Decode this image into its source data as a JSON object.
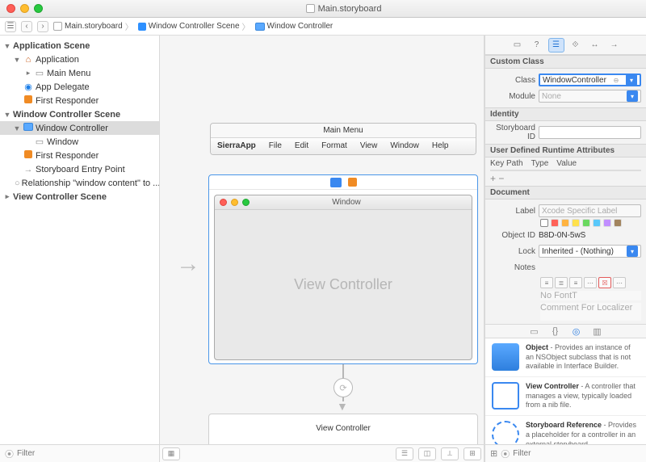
{
  "window_title": "Main.storyboard",
  "breadcrumb": [
    "Main.storyboard",
    "Window Controller Scene",
    "Window Controller"
  ],
  "outline": {
    "app_scene": "Application Scene",
    "application": "Application",
    "main_menu": "Main Menu",
    "app_delegate": "App Delegate",
    "first_responder": "First Responder",
    "wc_scene": "Window Controller Scene",
    "window_controller": "Window Controller",
    "window": "Window",
    "entry_point": "Storyboard Entry Point",
    "relationship": "Relationship \"window content\" to ...",
    "vc_scene": "View Controller Scene",
    "filter_placeholder": "Filter"
  },
  "canvas": {
    "menu_title": "Main Menu",
    "menu_items": [
      "SierraApp",
      "File",
      "Edit",
      "Format",
      "View",
      "Window",
      "Help"
    ],
    "window_title": "Window",
    "vc_placeholder": "View Controller",
    "vc_box": "View Controller"
  },
  "inspector": {
    "custom_class_hdr": "Custom Class",
    "class_label": "Class",
    "class_value": "WindowController",
    "module_label": "Module",
    "module_value": "None",
    "identity_hdr": "Identity",
    "storyboard_id_label": "Storyboard ID",
    "udra_hdr": "User Defined Runtime Attributes",
    "keypath": "Key Path",
    "type": "Type",
    "value": "Value",
    "document_hdr": "Document",
    "label_label": "Label",
    "label_placeholder": "Xcode Specific Label",
    "objectid_label": "Object ID",
    "objectid_value": "B8D-0N-5wS",
    "lock_label": "Lock",
    "lock_value": "Inherited - (Nothing)",
    "notes_label": "Notes",
    "nofont": "No Font",
    "comment_placeholder": "Comment For Localizer",
    "filter_placeholder": "Filter"
  },
  "library": {
    "object": {
      "title": "Object",
      "desc": " - Provides an instance of an NSObject subclass that is not available in Interface Builder."
    },
    "vc": {
      "title": "View Controller",
      "desc": " - A controller that manages a view, typically loaded from a nib file."
    },
    "sb": {
      "title": "Storyboard Reference",
      "desc": " - Provides a placeholder for a controller in an external storyboard."
    }
  }
}
